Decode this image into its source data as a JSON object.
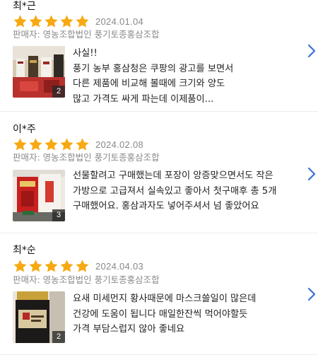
{
  "colors": {
    "star": "#f7a912",
    "chevron": "#3a6fd8",
    "seller": "#8a8a8a",
    "date": "#888888"
  },
  "icons": {
    "star": "star-icon",
    "chevron": "chevron-right-icon"
  },
  "reviews": [
    {
      "name": "최*근",
      "rating": 5,
      "date": "2024.01.04",
      "seller": "판매자: 영농조합법인 풍기토종홍삼조합",
      "photo_count": "2",
      "text": "사실!!\n풍기 농부 홍삼청은 쿠팡의 광고를 보면서\n다른 제품에 비교해 볼때에 크기와 양도\n많고 가격도 싸게 파는데 이제품이..."
    },
    {
      "name": "이*주",
      "rating": 5,
      "date": "2024.02.08",
      "seller": "판매자: 영농조합법인 풍기토종홍삼조합",
      "photo_count": "3",
      "text": "선물할려고 구매했는데 포장이 앙증맞으면서도 작은 가방으로 고급져서 실속있고 좋아서 첫구매후 총 5개 구매했어요. 홍삼과자도 넣어주셔서 넘 좋았어요"
    },
    {
      "name": "최*순",
      "rating": 5,
      "date": "2024.04.03",
      "seller": "판매자: 영농조합법인 풍기토종홍삼조합",
      "photo_count": "2",
      "text": "요새 미세먼지 황사때문에 마스크쓸일이 많은데\n건강에 도움이 됩니다 매일한잔씩 먹어야할듯\n가격 부담스럽지 않아 좋네요"
    }
  ]
}
